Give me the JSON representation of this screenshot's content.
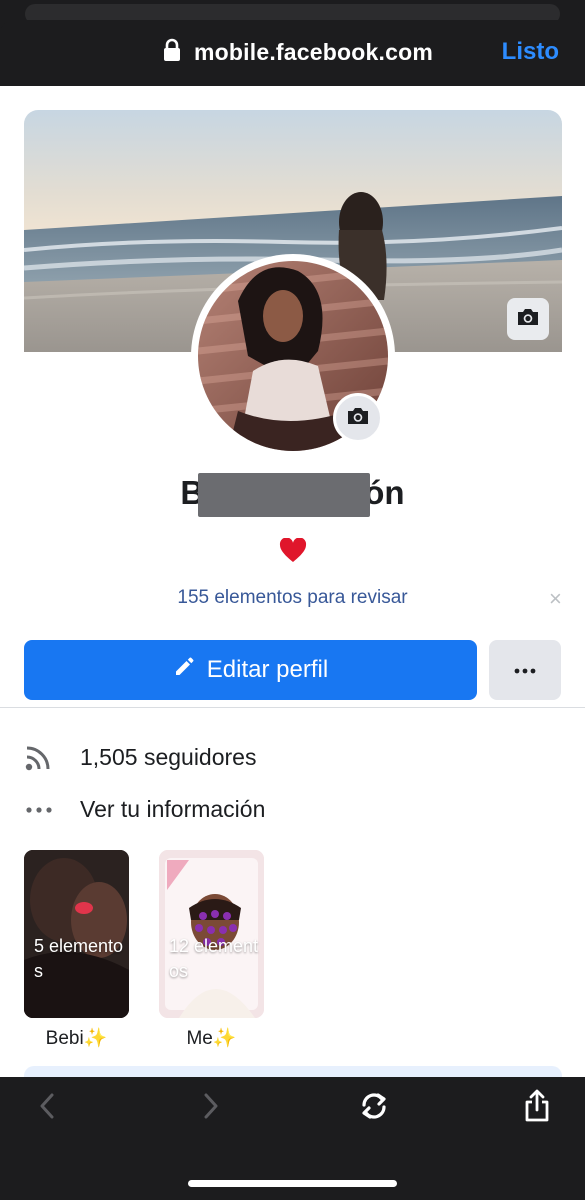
{
  "browser": {
    "url": "mobile.facebook.com",
    "done_label": "Listo"
  },
  "profile": {
    "name_prefix": "B",
    "name_suffix": "ón",
    "bio_emoji": "❤️",
    "review_link": "155 elementos para revisar",
    "review_close": "×",
    "edit_button_label": "Editar perfil",
    "more_button_label": "•••"
  },
  "info": {
    "followers": "1,505 seguidores",
    "see_info": "Ver tu información"
  },
  "highlights": [
    {
      "count": "5 elementos",
      "label": "Bebi✨"
    },
    {
      "count": "12 elementos",
      "label": "Me✨"
    }
  ],
  "icons": {
    "lock": "lock-icon",
    "camera": "camera-icon",
    "pencil": "pencil-icon",
    "rss": "rss-icon",
    "more": "more-icon",
    "back": "chevron-left-icon",
    "forward": "chevron-right-icon",
    "reload": "reload-icon",
    "share": "share-icon"
  },
  "colors": {
    "brand_blue": "#1877f2",
    "link_blue": "#385898",
    "done_blue": "#2d8cff",
    "toolbar": "#1c1c1e"
  }
}
